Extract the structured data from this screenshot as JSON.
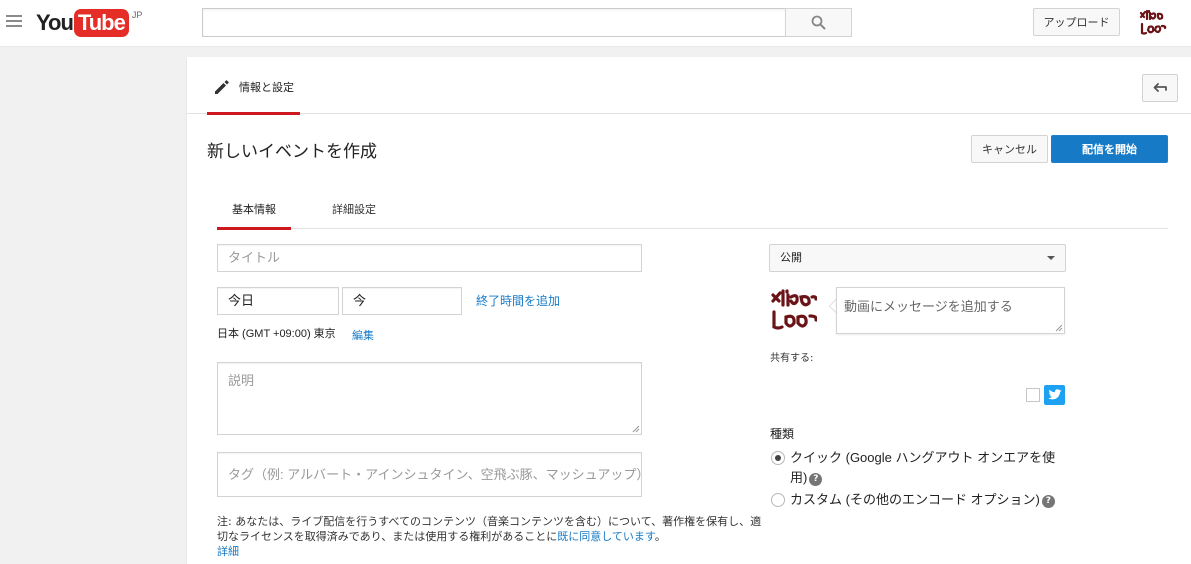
{
  "masthead": {
    "logo_you": "You",
    "logo_tube": "Tube",
    "logo_region": "JP",
    "search_placeholder": "",
    "search_icon": "magnifier-icon",
    "upload_label": "アップロード"
  },
  "panel": {
    "info_tab_label": "情報と設定",
    "page_title": "新しいイベントを作成",
    "cancel_label": "キャンセル",
    "start_label": "配信を開始",
    "tabs": [
      {
        "label": "基本情報",
        "active": true
      },
      {
        "label": "詳細設定",
        "active": false
      }
    ]
  },
  "form": {
    "title_placeholder": "タイトル",
    "date_value": "今日",
    "time_value": "今",
    "add_end_time": "終了時間を追加",
    "timezone": "日本 (GMT +09:00) 東京",
    "timezone_edit": "編集",
    "description_placeholder": "説明",
    "tags_placeholder": "タグ（例: アルバート・アインシュタイン、空飛ぶ豚、マッシュアップ）",
    "note_prefix": "注: あなたは、ライブ配信を行うすべてのコンテンツ（音楽コンテンツを含む）について、著作権を保有し、適切なライセンスを取得済みであり、または使用する権利があることに",
    "note_link": "既に同意しています",
    "note_suffix": "。",
    "note_details": "詳細"
  },
  "sidebar": {
    "privacy_value": "公開",
    "message_placeholder": "動画にメッセージを追加する",
    "share_label": "共有する:",
    "twitter_checked": false,
    "type_heading": "種類",
    "options": [
      {
        "label": "クイック (Google ハングアウト オンエアを使用)",
        "checked": true
      },
      {
        "label": "カスタム (その他のエンコード オプション)",
        "checked": false
      }
    ],
    "help_glyph": "?"
  },
  "colors": {
    "brand_red": "#cc181e",
    "primary_blue": "#167ac6",
    "twitter_blue": "#1da1f2"
  }
}
